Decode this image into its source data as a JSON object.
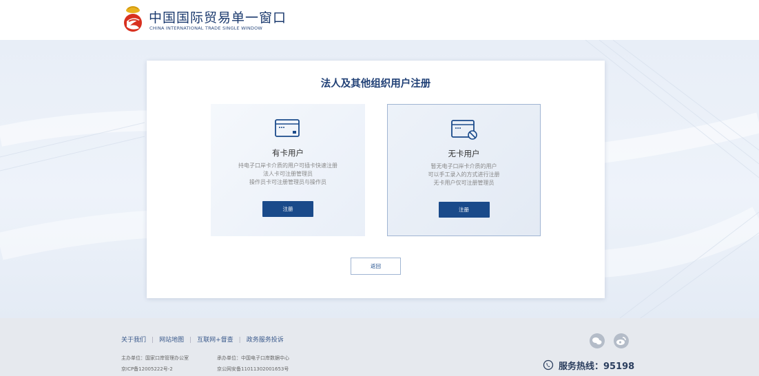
{
  "header": {
    "brand_cn": "中国国际贸易单一窗口",
    "brand_en": "CHINA INTERNATIONAL TRADE SINGLE WINDOW"
  },
  "panel": {
    "title": "法人及其他组织用户注册",
    "cards": [
      {
        "title": "有卡用户",
        "desc": [
          "持电子口岸卡介质的用户可插卡快速注册",
          "法人卡可注册管理员",
          "操作员卡可注册管理员与操作员"
        ],
        "button": "注册",
        "icon": "card-icon"
      },
      {
        "title": "无卡用户",
        "desc": [
          "暂无电子口岸卡介质的用户",
          "可以手工录入的方式进行注册",
          "无卡用户仅可注册管理员"
        ],
        "button": "注册",
        "icon": "card-ban-icon"
      }
    ],
    "back_button": "返回"
  },
  "footer": {
    "links": [
      "关于我们",
      "网站地图",
      "互联网+督查",
      "政务服务投诉"
    ],
    "host": "主办单位：国家口岸管理办公室",
    "operator": "承办单位：中国电子口岸数据中心",
    "icp": "京ICP备12005222号-2",
    "police": "京公网安备11011302001653号",
    "hotline": "服务热线：95198"
  },
  "colors": {
    "primary": "#1a4a8a",
    "title": "#1f3f75",
    "footer_bg": "#e6e9ee"
  }
}
